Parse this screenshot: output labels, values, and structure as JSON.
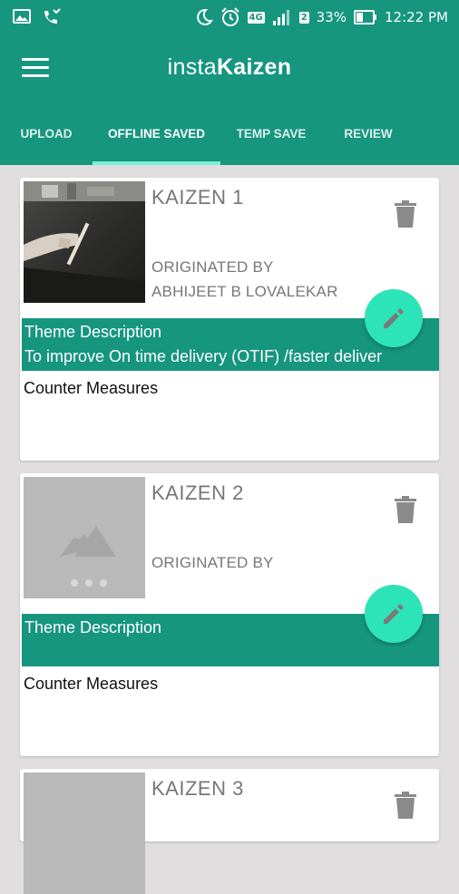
{
  "status_bar": {
    "network": "4G",
    "sim2": "2",
    "battery": "33%",
    "time": "12:22 PM",
    "icons": [
      "gallery-icon",
      "missed-call-icon",
      "moon-icon",
      "alarm-icon",
      "signal-icon",
      "battery-icon"
    ]
  },
  "app": {
    "title_prefix": "insta",
    "title_bold": "Kaizen",
    "accent_color": "#16957f",
    "fab_color": "#2de3b9"
  },
  "tabs": [
    {
      "label": "UPLOAD",
      "active": false
    },
    {
      "label": "OFFLINE SAVED",
      "active": true
    },
    {
      "label": "TEMP SAVE",
      "active": false
    },
    {
      "label": "REVIEW",
      "active": false
    }
  ],
  "cards": [
    {
      "title": "KAIZEN 1",
      "originated_label": "ORIGINATED BY",
      "originator": "ABHIJEET B LOVALEKAR",
      "theme_label": "Theme Description",
      "theme_value": "To improve On time delivery (OTIF) /faster deliver",
      "counter_label": "Counter Measures",
      "image": "photo"
    },
    {
      "title": "KAIZEN 2",
      "originated_label": "ORIGINATED BY",
      "originator": "",
      "theme_label": "Theme Description",
      "theme_value": "",
      "counter_label": "Counter Measures",
      "image": "placeholder"
    },
    {
      "title": "KAIZEN 3",
      "image": "placeholder"
    }
  ]
}
